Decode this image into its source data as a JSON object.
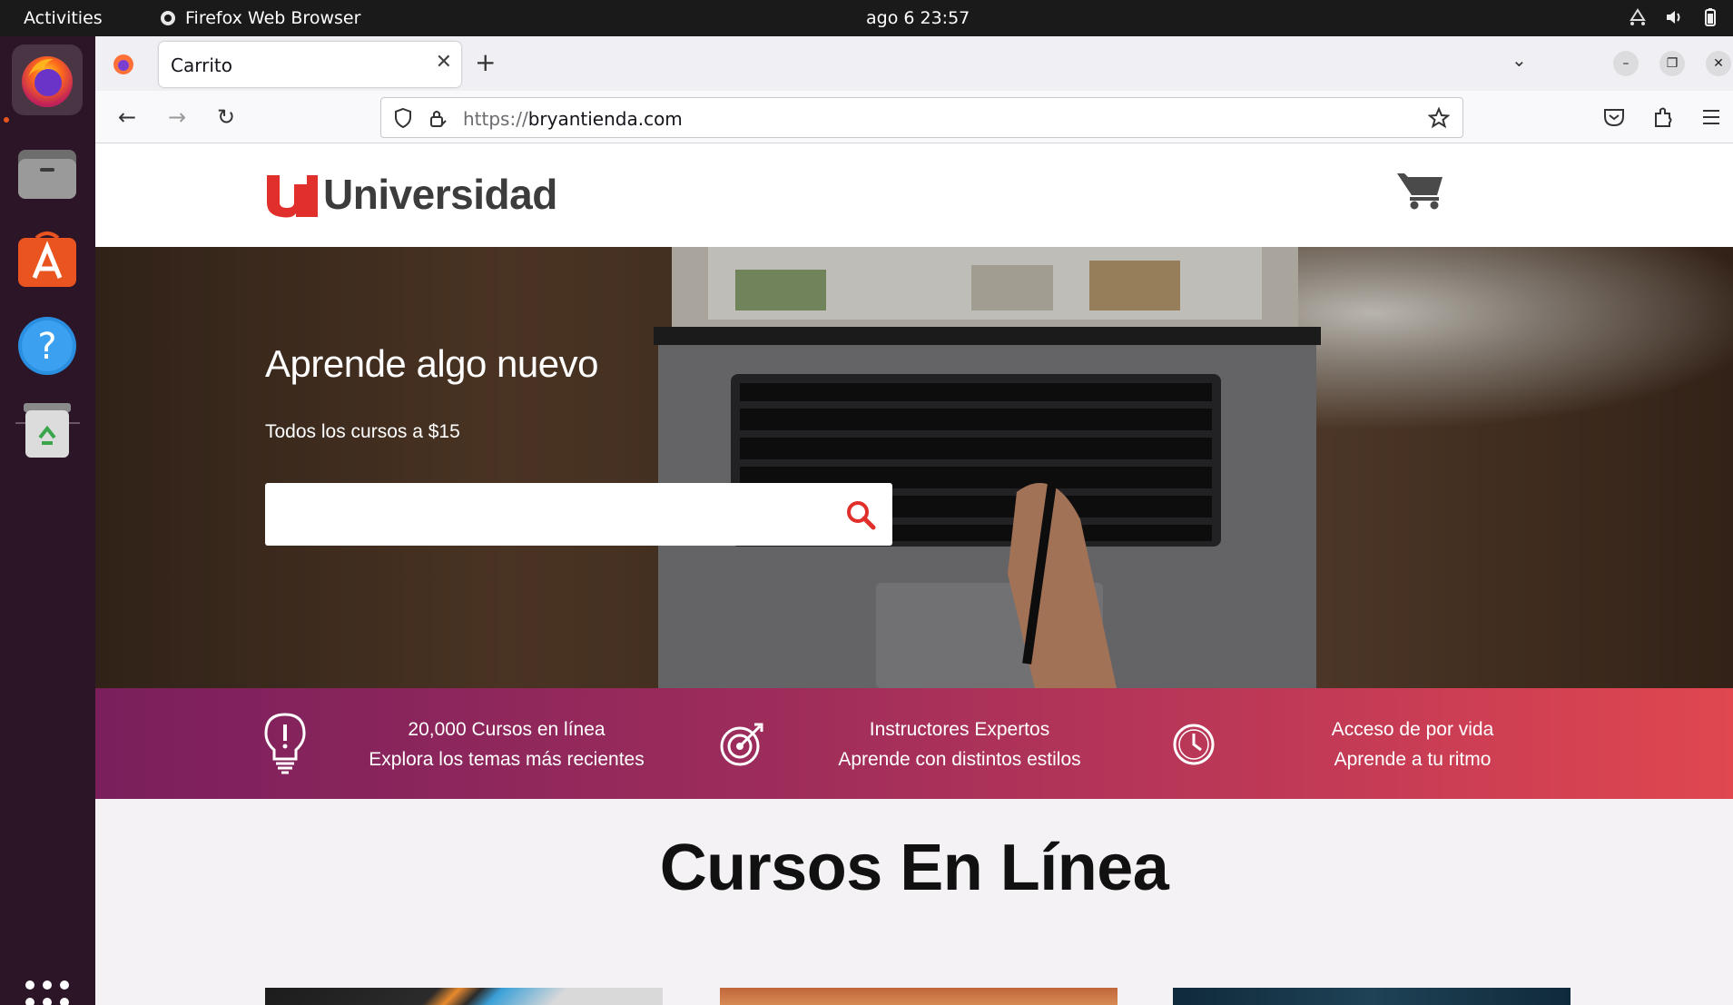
{
  "topbar": {
    "activities": "Activities",
    "app_name": "Firefox Web Browser",
    "clock": "ago 6  23:57"
  },
  "browser": {
    "tab_title": "Carrito",
    "url_proto": "https://",
    "url_host": "bryantienda.com"
  },
  "site": {
    "logo_text": "Universidad",
    "brand_color": "#e1302b",
    "hero": {
      "title": "Aprende algo nuevo",
      "subtitle": "Todos los cursos a $15",
      "search_placeholder": ""
    },
    "features": [
      {
        "icon": "lightbulb-icon",
        "line1": "20,000 Cursos en línea",
        "line2": "Explora los temas más recientes"
      },
      {
        "icon": "target-icon",
        "line1": "Instructores Expertos",
        "line2": "Aprende con distintos estilos"
      },
      {
        "icon": "clock-icon",
        "line1": "Acceso de por vida",
        "line2": "Aprende a tu ritmo"
      }
    ],
    "courses_title": "Cursos En Línea"
  }
}
